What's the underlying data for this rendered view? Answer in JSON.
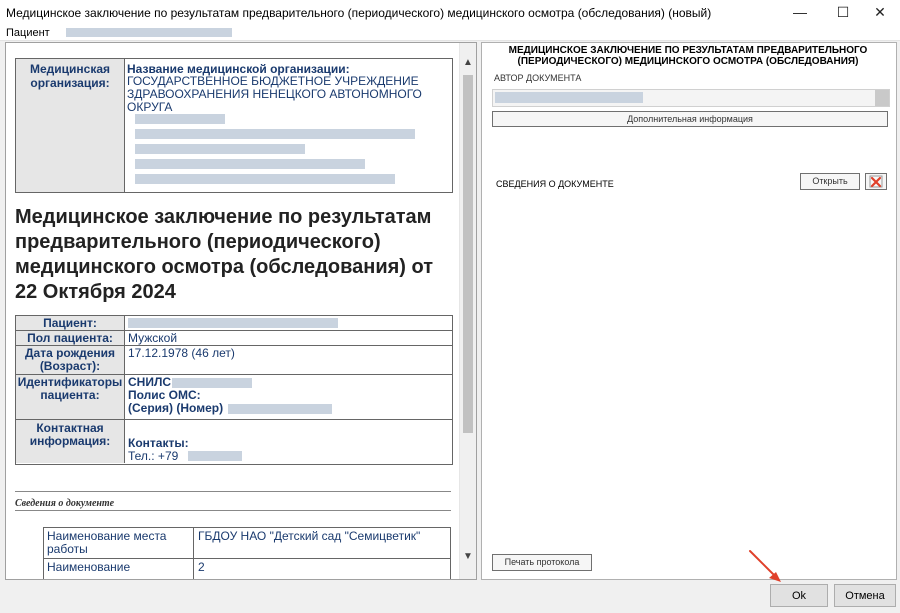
{
  "window": {
    "title": "Медицинское заключение по результатам предварительного (периодического) медицинского осмотра (обследования) (новый)",
    "minimize": "—",
    "maximize": "☐",
    "close": "✕"
  },
  "patient_bar": {
    "label": "Пациент"
  },
  "document": {
    "org": {
      "label": "Медицинская организация:",
      "name_header": "Название медицинской организации:",
      "name": "ГОСУДАРСТВЕННОЕ БЮДЖЕТНОЕ УЧРЕЖДЕНИЕ ЗДРАВООХРАНЕНИЯ НЕНЕЦКОГО АВТОНОМНОГО ОКРУГА"
    },
    "title": "Медицинское заключение по результатам предварительного (периодического) медицинского осмотра (обследования) от 22 Октября 2024",
    "patient_table": {
      "patient_label": "Пациент:",
      "sex_label": "Пол пациента:",
      "sex_value": "Мужской",
      "dob_label": "Дата рождения (Возраст):",
      "dob_value": "17.12.1978 (46 лет)",
      "ids_label": "Идентификаторы пациента:",
      "snils_label": "СНИЛС",
      "oms_label": "Полис ОМС:",
      "series_label": "(Серия) (Номер)",
      "contact_label": "Контактная информация:",
      "contacts_label": "Контакты:",
      "phone_prefix": "Тел.: +79"
    },
    "section_title": "Сведения о документе",
    "work_table": {
      "workplace_label": "Наименование места работы",
      "workplace_value": "ГБДОУ НАО \"Детский сад \"Семицветик\"",
      "name_label": "Наименование",
      "name_value": "2"
    }
  },
  "right_panel": {
    "title": "МЕДИЦИНСКОЕ ЗАКЛЮЧЕНИЕ ПО РЕЗУЛЬТАТАМ ПРЕДВАРИТЕЛЬНОГО (ПЕРИОДИЧЕСКОГО) МЕДИЦИНСКОГО ОСМОТРА (ОБСЛЕДОВАНИЯ)",
    "author_label": "АВТОР ДОКУМЕНТА",
    "additional_info_button": "Дополнительная информация",
    "doc_info_label": "СВЕДЕНИЯ О ДОКУМЕНТЕ",
    "open_button": "Открыть",
    "print_button": "Печать протокола"
  },
  "footer": {
    "ok": "Ok",
    "cancel": "Отмена"
  },
  "colors": {
    "accent_arrow": "#e0402a",
    "doc_text": "#1a3a6e"
  }
}
